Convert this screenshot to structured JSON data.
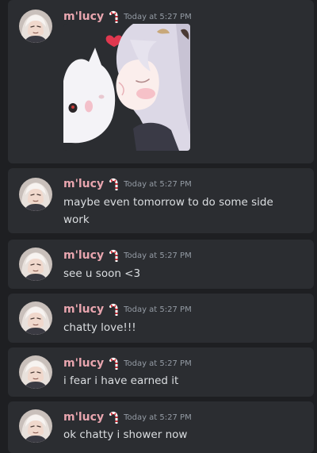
{
  "messages": [
    {
      "author": "m'lucy",
      "timestamp": "Today at 5:27 PM",
      "text": "",
      "has_image": true
    },
    {
      "author": "m'lucy",
      "timestamp": "Today at 5:27 PM",
      "text": "maybe even tomorrow to do some side work"
    },
    {
      "author": "m'lucy",
      "timestamp": "Today at 5:27 PM",
      "text": "see u soon <3"
    },
    {
      "author": "m'lucy",
      "timestamp": "Today at 5:27 PM",
      "text": "chatty love!!!"
    },
    {
      "author": "m'lucy",
      "timestamp": "Today at 5:27 PM",
      "text": "i fear i have earned it"
    },
    {
      "author": "m'lucy",
      "timestamp": "Today at 5:27 PM",
      "text": "ok chatty i shower now"
    }
  ],
  "colors": {
    "background": "#1e1f22",
    "message_bg": "#2b2d31",
    "username": "#e8a5ae",
    "text": "#dbdee1",
    "timestamp": "#949ba4"
  },
  "icons": {
    "badge": "candy-cane-badge-icon",
    "avatar": "user-avatar"
  }
}
